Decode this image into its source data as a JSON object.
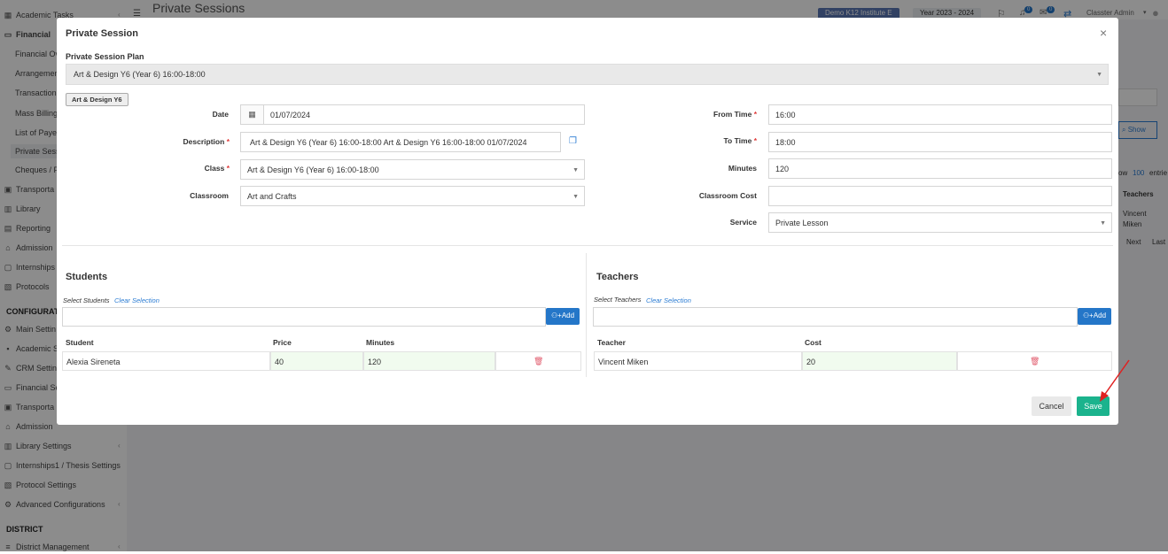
{
  "sidebar": {
    "items": [
      {
        "label": "Academic Tasks",
        "icon": "grid-icon"
      },
      {
        "label": "Financial",
        "icon": "card-icon"
      },
      {
        "label": "Financial Ov",
        "icon": ""
      },
      {
        "label": "Arrangemen",
        "icon": ""
      },
      {
        "label": "Transaction",
        "icon": ""
      },
      {
        "label": "Mass Billing",
        "icon": ""
      },
      {
        "label": "List of Payer",
        "icon": ""
      },
      {
        "label": "Private Sess",
        "icon": ""
      },
      {
        "label": "Cheques / P",
        "icon": ""
      },
      {
        "label": "Transporta",
        "icon": "bus-icon"
      },
      {
        "label": "Library",
        "icon": "books-icon"
      },
      {
        "label": "Reporting",
        "icon": "chart-icon"
      },
      {
        "label": "Admission",
        "icon": "building-icon"
      },
      {
        "label": "Internships",
        "icon": "briefcase-icon"
      },
      {
        "label": "Protocols",
        "icon": "document-icon"
      },
      {
        "label": "CONFIGURATI",
        "icon": ""
      },
      {
        "label": "Main Settin",
        "icon": "gear-icon"
      },
      {
        "label": "Academic S",
        "icon": "people-icon"
      },
      {
        "label": "CRM Settin",
        "icon": "tools-icon"
      },
      {
        "label": "Financial Se",
        "icon": "card-icon"
      },
      {
        "label": "Transporta",
        "icon": "bus-icon"
      },
      {
        "label": "Admission",
        "icon": "building-icon"
      },
      {
        "label": "Library Settings",
        "icon": "books-icon"
      },
      {
        "label": "Internships1 / Thesis Settings",
        "icon": "briefcase-icon"
      },
      {
        "label": "Protocol Settings",
        "icon": "document-icon"
      },
      {
        "label": "Advanced Configurations",
        "icon": "gears-icon"
      },
      {
        "label": "DISTRICT",
        "icon": ""
      },
      {
        "label": "District Management",
        "icon": "list-icon"
      }
    ]
  },
  "header": {
    "page_title": "Private Sessions",
    "institute": "Demo K12 Institute E",
    "year": "Year 2023 - 2024",
    "badge1": "0",
    "badge2": "0",
    "user": "Classter Admin"
  },
  "background": {
    "show_button": "Show",
    "show_entries_prefix": "ow",
    "show_entries_count": "100",
    "show_entries_suffix": "entrie",
    "teachers_header": "Teachers",
    "teacher_cell_1": "Vincent",
    "teacher_cell_2": "Miken",
    "next": "Next",
    "last": "Last"
  },
  "modal": {
    "title": "Private Session",
    "close": "×",
    "plan_label": "Private Session Plan",
    "plan_value": "Art & Design Y6 (Year 6) 16:00-18:00",
    "tag": "Art & Design Y6",
    "left_fields": {
      "date_label": "Date",
      "date_value": "01/07/2024",
      "description_label": "Description",
      "description_value": "Art & Design Y6 (Year 6) 16:00-18:00 Art & Design Y6 16:00-18:00 01/07/2024",
      "class_label": "Class",
      "class_value": "Art & Design Y6 (Year 6) 16:00-18:00",
      "classroom_label": "Classroom",
      "classroom_value": "Art and Crafts"
    },
    "right_fields": {
      "from_label": "From Time",
      "from_value": "16:00",
      "to_label": "To Time",
      "to_value": "18:00",
      "minutes_label": "Minutes",
      "minutes_value": "120",
      "cost_label": "Classroom Cost",
      "cost_value": "",
      "service_label": "Service",
      "service_value": "Private Lesson"
    },
    "required_mark": "*",
    "students": {
      "title": "Students",
      "select_label": "Select Students",
      "clear": "Clear Selection",
      "add": "Add",
      "columns": [
        "Student",
        "Price",
        "Minutes"
      ],
      "rows": [
        {
          "student": "Alexia Sireneta",
          "price": "40",
          "minutes": "120"
        }
      ]
    },
    "teachers": {
      "title": "Teachers",
      "select_label": "Select Teachers",
      "clear": "Clear Selection",
      "add": "Add",
      "columns": [
        "Teacher",
        "Cost"
      ],
      "rows": [
        {
          "teacher": "Vincent Miken",
          "cost": "20"
        }
      ]
    },
    "cancel": "Cancel",
    "save": "Save"
  },
  "colors": {
    "save": "#1bb38d",
    "add": "#2476c8",
    "link": "#2b7cd3",
    "required": "#e03a3a",
    "arrow": "#e02020"
  }
}
